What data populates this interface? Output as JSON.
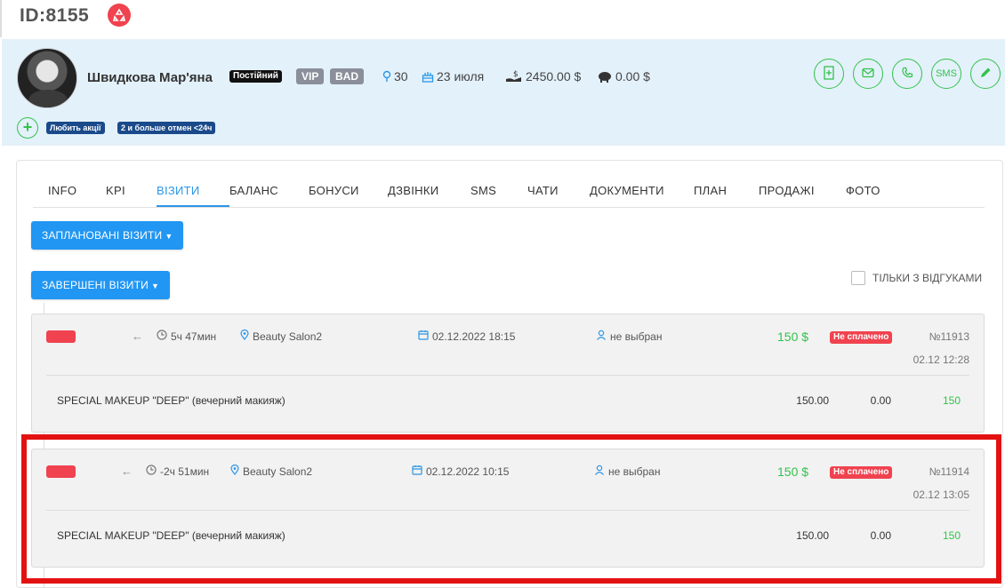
{
  "header": {
    "client_id": "ID:8155",
    "recycle_icon": "recycle-icon"
  },
  "profile": {
    "name": "Швидкова Мар'яна",
    "badges": {
      "permanent": "Постійний",
      "vip": "VIP",
      "bad": "BAD"
    },
    "age": "30",
    "birthday": "23 июля",
    "balance": "2450.00 $",
    "savings": "0.00 $",
    "actions": {
      "sms": "SMS"
    },
    "tags": [
      "Любить акції",
      "2 и больше отмен <24ч"
    ],
    "colors": {
      "accent_green": "#33c24a",
      "badge_blue": "#1a4a8a",
      "band": "#e3f1fb"
    }
  },
  "tabs": [
    "INFO",
    "KPI",
    "ВІЗИТИ",
    "БАЛАНС",
    "БОНУСИ",
    "ДЗВІНКИ",
    "SMS",
    "ЧАТИ",
    "ДОКУМЕНТИ",
    "ПЛАН",
    "ПРОДАЖІ",
    "ФОТО"
  ],
  "active_tab": "ВІЗИТИ",
  "buttons": {
    "planned": "ЗАПЛАНОВАНІ ВІЗИТИ",
    "completed": "ЗАВЕРШЕНІ ВІЗИТИ"
  },
  "filter": {
    "only_reviews": "ТІЛЬКИ З ВІДГУКАМИ"
  },
  "visits": [
    {
      "duration": "5ч 47мин",
      "salon": "Beauty Salon2",
      "date": "02.12.2022 18:15",
      "master": "не выбран",
      "price": "150 $",
      "payment": "Не сплачено",
      "number": "№11913",
      "created": "02.12 12:28",
      "service": "SPECIAL MAKEUP \"DEEP\" (вечерний макияж)",
      "cost": "150.00",
      "discount": "0.00",
      "total": "150"
    },
    {
      "duration": "-2ч 51мин",
      "salon": "Beauty Salon2",
      "date": "02.12.2022 10:15",
      "master": "не выбран",
      "price": "150 $",
      "payment": "Не сплачено",
      "number": "№11914",
      "created": "02.12 13:05",
      "service": "SPECIAL MAKEUP \"DEEP\" (вечерний макияж)",
      "cost": "150.00",
      "discount": "0.00",
      "total": "150"
    }
  ]
}
